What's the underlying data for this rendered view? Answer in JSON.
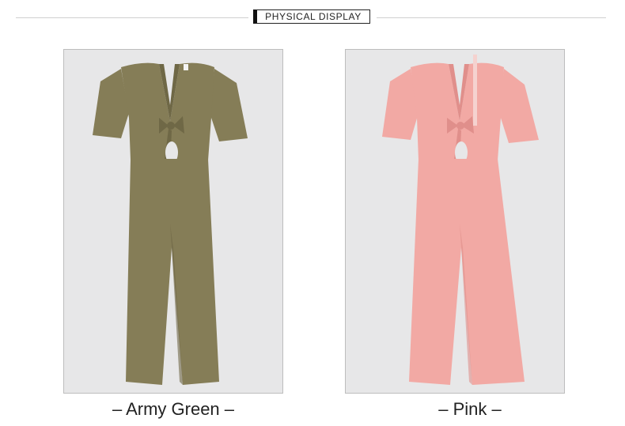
{
  "header": {
    "title": "PHYSICAL DISPLAY"
  },
  "products": [
    {
      "caption": "– Army Green –",
      "color": "#857d57",
      "shade": "#6f6846"
    },
    {
      "caption": "– Pink –",
      "color": "#f2a9a4",
      "shade": "#e08f8b"
    }
  ],
  "colors": {
    "panel_bg": "#e7e7e8",
    "border": "#bdbdbd"
  }
}
